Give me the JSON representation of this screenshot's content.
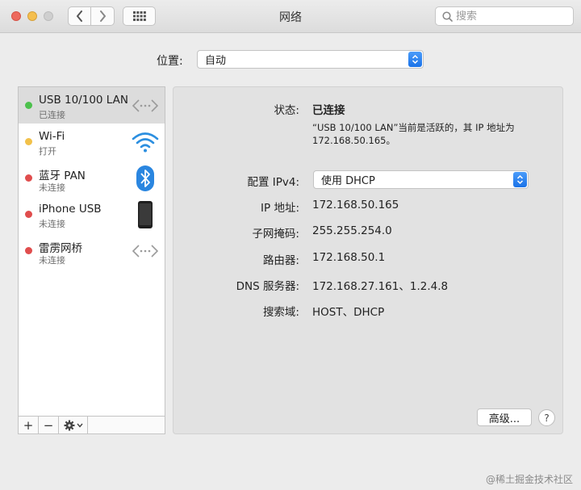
{
  "window": {
    "title": "网络"
  },
  "search": {
    "placeholder": "搜索"
  },
  "location": {
    "label": "位置:",
    "value": "自动"
  },
  "services": [
    {
      "name": "USB 10/100 LAN",
      "status": "已连接",
      "dot": "#4cc14c",
      "icon": "ethernet-icon"
    },
    {
      "name": "Wi-Fi",
      "status": "打开",
      "dot": "#f2c14a",
      "icon": "wifi-icon"
    },
    {
      "name": "蓝牙 PAN",
      "status": "未连接",
      "dot": "#e04d4d",
      "icon": "bluetooth-icon"
    },
    {
      "name": "iPhone USB",
      "status": "未连接",
      "dot": "#e04d4d",
      "icon": "iphone-icon"
    },
    {
      "name": "雷雳网桥",
      "status": "未连接",
      "dot": "#e04d4d",
      "icon": "thunderbolt-bridge-icon"
    }
  ],
  "sidebar_tools": {
    "add": "+",
    "remove": "−"
  },
  "details": {
    "status_label": "状态:",
    "status_value": "已连接",
    "status_desc_line1": "“USB 10/100 LAN”当前是活跃的，其 IP 地址为",
    "status_desc_line2": "172.168.50.165。",
    "config_label": "配置 IPv4:",
    "config_value": "使用 DHCP",
    "ip_label": "IP 地址:",
    "ip_value": "172.168.50.165",
    "subnet_label": "子网掩码:",
    "subnet_value": "255.255.254.0",
    "router_label": "路由器:",
    "router_value": "172.168.50.1",
    "dns_label": "DNS 服务器:",
    "dns_value": "172.168.27.161、1.2.4.8",
    "search_domain_label": "搜索域:",
    "search_domain_value": "HOST、DHCP",
    "advanced_button": "高级...",
    "help_button": "?"
  },
  "watermark": "@稀土掘金技术社区",
  "colors": {
    "accent": "#1a72e8",
    "panel": "#e2e2e2",
    "selected": "#dcdcdc"
  }
}
